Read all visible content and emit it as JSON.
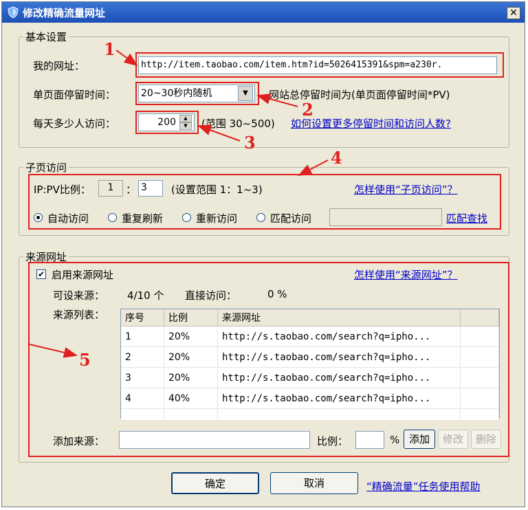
{
  "window": {
    "title": "修改精确流量网址",
    "close_label": "✕"
  },
  "basic": {
    "legend": "基本设置",
    "url_label": "我的网址：",
    "url_value": "http://item.taobao.com/item.htm?id=5026415391&spm=a230r.",
    "stay_label": "单页面停留时间：",
    "stay_value": "20~30秒内随机",
    "stay_note": "网站总停留时间为(单页面停留时间*PV)",
    "visitors_label": "每天多少人访问：",
    "visitors_value": "200",
    "visitors_range": "(范围 30~500)",
    "help_link": "如何设置更多停留时间和访问人数?"
  },
  "subpage": {
    "legend": "子页访问",
    "ratio_label": "IP:PV比例：",
    "ratio_left": "1",
    "ratio_sep": "：",
    "ratio_right": "3",
    "ratio_range": "(设置范围 1：1~3)",
    "help_link": "怎样使用“子页访问”？",
    "modes": [
      {
        "label": "自动访问",
        "selected": true
      },
      {
        "label": "重复刷新",
        "selected": false
      },
      {
        "label": "重新访问",
        "selected": false
      },
      {
        "label": "匹配访问",
        "selected": false
      }
    ],
    "match_value": "",
    "match_link": "匹配查找"
  },
  "source": {
    "legend": "来源网址",
    "enable_label": "启用来源网址",
    "enabled": true,
    "help_link": "怎样使用“来源网址”？",
    "settable_label": "可设来源：",
    "settable_value": "4/10 个",
    "direct_label": "直接访问：",
    "direct_value": "0 %",
    "list_label": "来源列表：",
    "columns": [
      "序号",
      "比例",
      "来源网址"
    ],
    "rows": [
      [
        "1",
        "20%",
        "http://s.taobao.com/search?q=ipho..."
      ],
      [
        "2",
        "20%",
        "http://s.taobao.com/search?q=ipho..."
      ],
      [
        "3",
        "20%",
        "http://s.taobao.com/search?q=ipho..."
      ],
      [
        "4",
        "40%",
        "http://s.taobao.com/search?q=ipho..."
      ]
    ],
    "add_label": "添加来源：",
    "add_value": "",
    "ratio_label": "比例：",
    "ratio_value": "",
    "percent": "%",
    "add_button": "添加",
    "edit_button": "修改",
    "delete_button": "删除"
  },
  "footer": {
    "ok": "确定",
    "cancel": "取消",
    "help_link": "“精确流量”任务使用帮助"
  },
  "annotations": [
    "1",
    "2",
    "3",
    "4",
    "5"
  ],
  "colors": {
    "annotation": "#e0201e",
    "title_bar": "#1c4fb5",
    "link": "#0000cc",
    "dialog_bg": "#ece9d8"
  }
}
